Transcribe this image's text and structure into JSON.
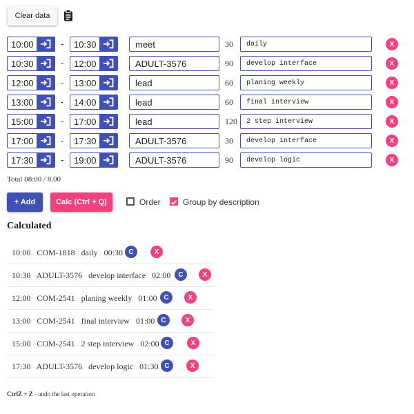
{
  "toolbar": {
    "clear_label": "Clear data",
    "clipboard_icon": "clipboard-icon"
  },
  "rows": [
    {
      "start": "10:00",
      "end": "10:30",
      "task": "meet",
      "minutes": "30",
      "description": "daily"
    },
    {
      "start": "10:30",
      "end": "12:00",
      "task": "ADULT-3576",
      "minutes": "90",
      "description": "develop interface"
    },
    {
      "start": "12:00",
      "end": "13:00",
      "task": "lead",
      "minutes": "60",
      "description": "planing weekly"
    },
    {
      "start": "13:00",
      "end": "14:00",
      "task": "lead",
      "minutes": "60",
      "description": "final interview"
    },
    {
      "start": "15:00",
      "end": "17:00",
      "task": "lead",
      "minutes": "120",
      "description": "2 step interview"
    },
    {
      "start": "17:00",
      "end": "17:30",
      "task": "ADULT-3576",
      "minutes": "30",
      "description": "develop interface"
    },
    {
      "start": "17:30",
      "end": "19:00",
      "task": "ADULT-3576",
      "minutes": "90",
      "description": "develop logic"
    }
  ],
  "row_separator": "-",
  "delete_label": "X",
  "total": "Total 08:00 / 8.00",
  "actions": {
    "add_label": "+ Add",
    "calc_label": "Calc (Ctrl + Q)",
    "order_label": "Order",
    "order_checked": false,
    "group_label": "Group by description",
    "group_checked": true
  },
  "calculated": {
    "title": "Calculated",
    "copy_label": "C",
    "remove_label": "X",
    "items": [
      {
        "text": "10:00   COM-1818   daily   00:30"
      },
      {
        "text": "10:30   ADULT-3576   develop interface   02:00"
      },
      {
        "text": "12:00   COM-2541   planing weekly   01:00"
      },
      {
        "text": "13:00   COM-2541   final interview   01:00"
      },
      {
        "text": "15:00   COM-2541   2 step interview   02:00"
      },
      {
        "text": "17:30   ADULT-3576   develop logic   01:30"
      }
    ]
  },
  "note": {
    "bold": "CtrlZ + Z",
    "rest": " - undo the last operation"
  },
  "colors": {
    "primary": "#3f51b5",
    "accent": "#f44081"
  }
}
